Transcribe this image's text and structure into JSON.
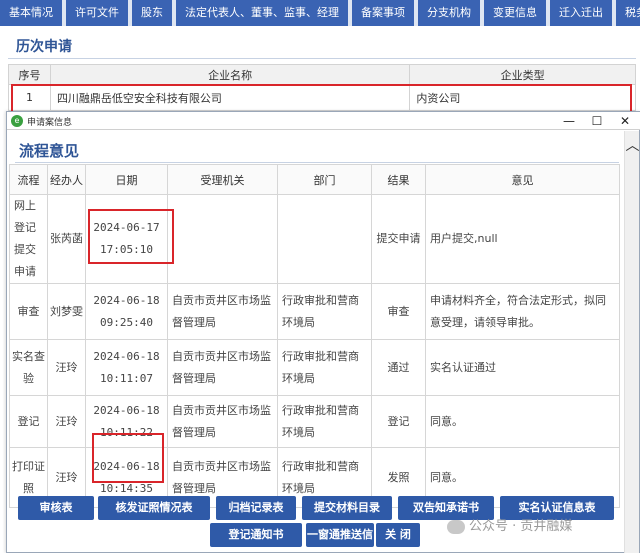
{
  "tabs": [
    "基本情况",
    "许可文件",
    "股东",
    "法定代表人、董事、监事、经理",
    "备案事项",
    "分支机构",
    "变更信息",
    "迁入迁出",
    "税务"
  ],
  "history": {
    "title": "历次申请",
    "headers": [
      "序号",
      "企业名称",
      "企业类型"
    ],
    "row": {
      "index": "1",
      "name": "四川融鼎岳低空安全科技有限公司",
      "type": "内资公司"
    }
  },
  "dialog": {
    "title": "申请案信息",
    "minimize": "—",
    "maximize": "☐",
    "close": "✕",
    "section_title": "流程意见",
    "headers": [
      "流程",
      "经办人",
      "日期",
      "受理机关",
      "部门",
      "结果",
      "意见"
    ],
    "rows": [
      {
        "flow": "网上登记提交申请",
        "handler": "张芮菡",
        "date": "2024-06-17",
        "time": "17:05:10",
        "agency": "",
        "dept": "",
        "result": "提交申请",
        "opinion": "用户提交,null"
      },
      {
        "flow": "审查",
        "handler": "刘梦雯",
        "date": "2024-06-18",
        "time": "09:25:40",
        "agency": "自贡市贡井区市场监督管理局",
        "dept": "行政审批和营商环境局",
        "result": "审查",
        "opinion": "申请材料齐全，符合法定形式，拟同意受理，请领导审批。"
      },
      {
        "flow": "实名查验",
        "handler": "汪玲",
        "date": "2024-06-18",
        "time": "10:11:07",
        "agency": "自贡市贡井区市场监督管理局",
        "dept": "行政审批和营商环境局",
        "result": "通过",
        "opinion": "实名认证通过"
      },
      {
        "flow": "登记",
        "handler": "汪玲",
        "date": "2024-06-18",
        "time": "10:11:22",
        "agency": "自贡市贡井区市场监督管理局",
        "dept": "行政审批和营商环境局",
        "result": "登记",
        "opinion": "同意。"
      },
      {
        "flow": "打印证照",
        "handler": "汪玲",
        "date": "2024-06-18",
        "time": "10:14:35",
        "agency": "自贡市贡井区市场监督管理局",
        "dept": "行政审批和营商环境局",
        "result": "发照",
        "opinion": "同意。"
      }
    ],
    "buttons": [
      "审核表",
      "核发证照情况表",
      "归档记录表",
      "提交材料目录",
      "双告知承诺书",
      "实名认证信息表",
      "登记通知书",
      "一窗通推送信",
      "关 闭"
    ]
  },
  "watermark": "公众号 · 贡井融媒",
  "colors": {
    "tab_blue": "#3a63b3",
    "button_blue": "#2f5aa8",
    "title_blue": "#2f5596",
    "highlight_red": "#d9252a"
  }
}
